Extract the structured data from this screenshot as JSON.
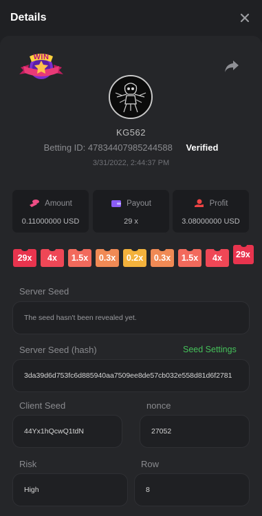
{
  "header": {
    "title": "Details"
  },
  "bet": {
    "badge_text": "WIN",
    "username": "KG562",
    "betting_label": "Betting ID:",
    "betting_id": "47834407985244588",
    "verified": "Verified",
    "timestamp": "3/31/2022, 2:44:37 PM"
  },
  "stats": {
    "amount": {
      "label": "Amount",
      "value": "0.11000000 USD",
      "icon": "coin-stack-icon",
      "color": "#ef4e86"
    },
    "payout": {
      "label": "Payout",
      "value": "29 x",
      "icon": "wallet-icon",
      "color": "#8b5cf6"
    },
    "profit": {
      "label": "Profit",
      "value": "3.08000000 USD",
      "icon": "money-hand-icon",
      "color": "#ef4444"
    }
  },
  "multipliers": [
    {
      "label": "29x",
      "color": "#e8344e"
    },
    {
      "label": "4x",
      "color": "#ef4756"
    },
    {
      "label": "1.5x",
      "color": "#f26a5c"
    },
    {
      "label": "0.3x",
      "color": "#f08a55"
    },
    {
      "label": "0.2x",
      "color": "#f3b23c"
    },
    {
      "label": "0.3x",
      "color": "#f08a55"
    },
    {
      "label": "1.5x",
      "color": "#f26a5c"
    },
    {
      "label": "4x",
      "color": "#ef4756"
    },
    {
      "label": "29x",
      "color": "#e8344e"
    }
  ],
  "fields": {
    "server_seed_label": "Server Seed",
    "server_seed_value": "The seed hasn't been revealed yet.",
    "server_seed_hash_label": "Server Seed (hash)",
    "seed_settings": "Seed Settings",
    "server_seed_hash_value": "3da39d6d753fc6d885940aa7509ee8de57cb032e558d81d6f2781",
    "client_seed_label": "Client Seed",
    "client_seed_value": "44Yx1hQcwQ1tdN",
    "nonce_label": "nonce",
    "nonce_value": "27052",
    "risk_label": "Risk",
    "risk_value": "High",
    "row_label": "Row",
    "row_value": "8"
  }
}
